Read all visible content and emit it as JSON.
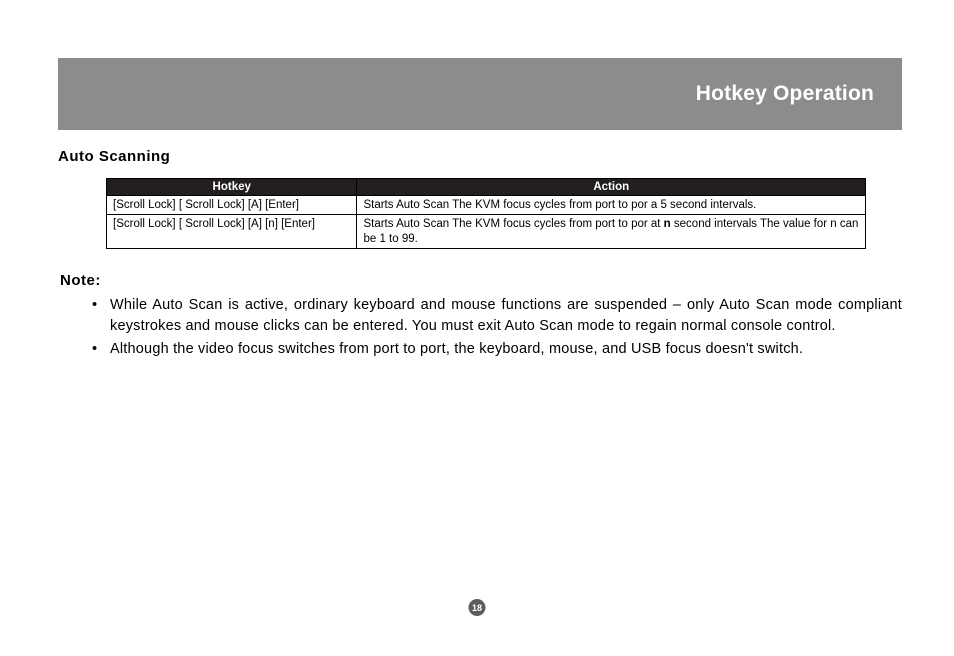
{
  "header": {
    "title": "Hotkey Operation"
  },
  "section": {
    "heading": "Auto Scanning"
  },
  "table": {
    "headers": {
      "hotkey": "Hotkey",
      "action": "Action"
    },
    "rows": [
      {
        "hotkey": "[Scroll Lock] [ Scroll Lock] [A] [Enter]",
        "action": "Starts Auto Scan   The KVM focus cycles from port to por  a  5 second intervals."
      },
      {
        "hotkey": "[Scroll Lock] [ Scroll Lock] [A] [n] [Enter]",
        "action_pre": "Starts Auto Scan   The KVM focus cycles from port to por  at ",
        "action_bold": "n",
        "action_post": " second intervals   The value for n can be 1 to 99."
      }
    ]
  },
  "note": {
    "heading": "Note:",
    "items": [
      "While Auto Scan is active, ordinary keyboard and mouse functions are suspended – only Auto Scan mode compliant keystrokes and mouse clicks can be entered.  You must exit Auto Scan mode to regain normal console control.",
      "Although the video focus switches from port to port, the keyboard, mouse, and USB focus doesn't switch."
    ]
  },
  "page_number": "18"
}
